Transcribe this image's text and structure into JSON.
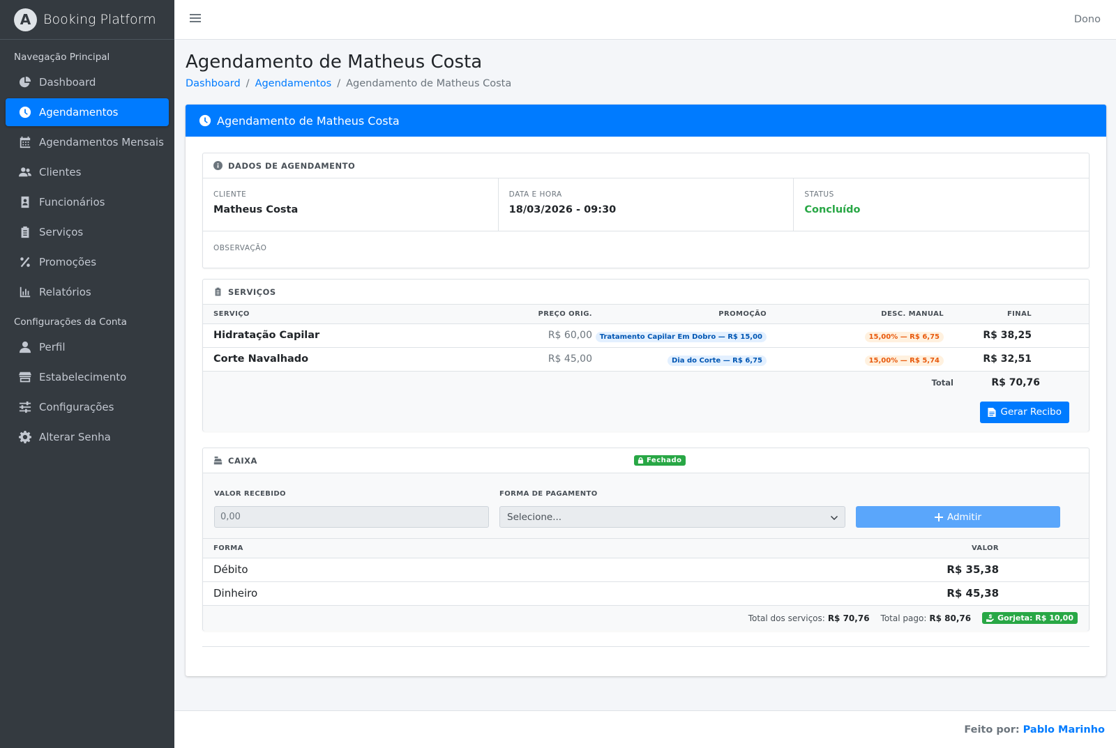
{
  "app": {
    "brand": "Booking Platform",
    "brand_initial": "A"
  },
  "sidebar": {
    "section_main": "Navegação Principal",
    "main_items": [
      {
        "label": "Dashboard",
        "icon": "chart-pie-icon"
      },
      {
        "label": "Agendamentos",
        "icon": "clock-icon",
        "active": true
      },
      {
        "label": "Agendamentos Mensais",
        "icon": "calendar-icon"
      },
      {
        "label": "Clientes",
        "icon": "users-icon"
      },
      {
        "label": "Funcionários",
        "icon": "id-badge-icon"
      },
      {
        "label": "Serviços",
        "icon": "clipboard-icon"
      },
      {
        "label": "Promoções",
        "icon": "percent-icon"
      },
      {
        "label": "Relatórios",
        "icon": "bar-chart-icon"
      }
    ],
    "section_account": "Configurações da Conta",
    "account_items": [
      {
        "label": "Perfil",
        "icon": "user-icon"
      },
      {
        "label": "Estabelecimento",
        "icon": "store-icon"
      },
      {
        "label": "Configurações",
        "icon": "sliders-icon"
      },
      {
        "label": "Alterar Senha",
        "icon": "gear-icon"
      }
    ]
  },
  "topbar": {
    "user": "Dono"
  },
  "page": {
    "title": "Agendamento de Matheus Costa",
    "breadcrumb": [
      "Dashboard",
      "Agendamentos",
      "Agendamento de Matheus Costa"
    ]
  },
  "card": {
    "header": "Agendamento de Matheus Costa"
  },
  "dados": {
    "header": "DADOS DE AGENDAMENTO",
    "cliente_label": "CLIENTE",
    "cliente_value": "Matheus Costa",
    "data_label": "DATA E HORA",
    "data_value": "18/03/2026 - 09:30",
    "status_label": "STATUS",
    "status_value": "Concluído",
    "obs_label": "OBSERVAÇÃO"
  },
  "servicos": {
    "header": "SERVIÇOS",
    "columns": [
      "SERVIÇO",
      "PREÇO ORIG.",
      "PROMOÇÃO",
      "DESC. MANUAL",
      "FINAL"
    ],
    "rows": [
      {
        "servico": "Hidratação Capilar",
        "preco": "R$ 60,00",
        "promocao": "Tratamento Capilar Em Dobro — R$ 15,00",
        "desc": "15,00% — R$ 6,75",
        "final": "R$ 38,25"
      },
      {
        "servico": "Corte Navalhado",
        "preco": "R$ 45,00",
        "promocao": "Dia do Corte — R$ 6,75",
        "desc": "15,00% — R$ 5,74",
        "final": "R$ 32,51"
      }
    ],
    "total_label": "Total",
    "total_value": "R$ 70,76",
    "recibo_button": "Gerar Recibo"
  },
  "caixa": {
    "header": "CAIXA",
    "status_badge": "Fechado",
    "valor_label": "VALOR RECEBIDO",
    "valor_placeholder": "0,00",
    "forma_label": "FORMA DE PAGAMENTO",
    "forma_selected": "Selecione...",
    "admitir_button": "Admitir",
    "columns": [
      "FORMA",
      "VALOR"
    ],
    "rows": [
      {
        "forma": "Débito",
        "valor": "R$ 35,38"
      },
      {
        "forma": "Dinheiro",
        "valor": "R$ 45,38"
      }
    ],
    "total_servicos_label": "Total dos serviços:",
    "total_servicos_value": "R$ 70,76",
    "total_pago_label": "Total pago:",
    "total_pago_value": "R$ 80,76",
    "gorjeta": "Gorjeta: R$ 10,00"
  },
  "footer": {
    "label": "Feito por:",
    "author": "Pablo Marinho"
  },
  "colors": {
    "primary": "#007bff",
    "sidebar": "#343a40",
    "success": "#28a745",
    "warning": "#e8590c"
  }
}
